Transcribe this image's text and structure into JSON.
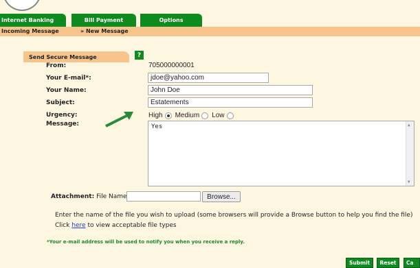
{
  "nav": {
    "tabs": [
      "Internet Banking",
      "Bill Payment",
      "Options"
    ]
  },
  "subnav": {
    "incoming": "Incoming Message",
    "new_message": "» New Message"
  },
  "section": {
    "title": "Send Secure Message",
    "help": "?"
  },
  "form": {
    "from_label": "From:",
    "from_value": "705000000001",
    "email_label": "Your E-mail*:",
    "email_value": "jdoe@yahoo.com",
    "name_label": "Your Name:",
    "name_value": "John Doe",
    "subject_label": "Subject:",
    "subject_value": "Estatements",
    "urgency_label": "Urgency:",
    "urgency_options": [
      "High",
      "Medium",
      "Low"
    ],
    "urgency_selected": "High",
    "message_label": "Message:",
    "message_value": "Yes",
    "attachment_label": "Attachment:",
    "file_name_label": "File Name:",
    "browse_label": "Browse..."
  },
  "info": {
    "upload_help": "Enter the name of the file you wish to upload (some browsers will provide a Browse button to help you find the file)",
    "click_prefix": "Click ",
    "here_link": "here",
    "click_suffix": " to view acceptable file types",
    "email_note": "*Your e-mail address will be used to notify you when you receive a reply."
  },
  "actions": {
    "submit": "Submit",
    "reset": "Reset",
    "cancel": "Ca"
  },
  "colors": {
    "accent_green": "#0e8a1f",
    "tab_orange": "#f7c58c",
    "background": "#fdf6e0"
  }
}
